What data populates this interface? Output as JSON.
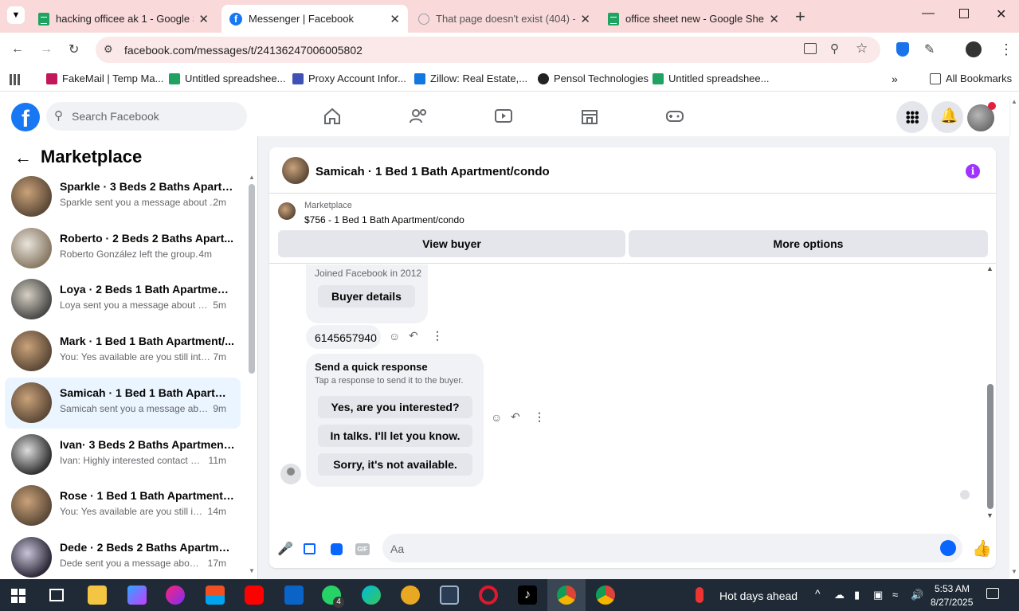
{
  "browser": {
    "tabs": [
      {
        "title": "hacking officee ak 1 - Google S",
        "icon": "google-sheets-icon"
      },
      {
        "title": "Messenger | Facebook",
        "icon": "facebook-icon"
      },
      {
        "title": "That page doesn't exist (404) -",
        "icon": "error-icon"
      },
      {
        "title": "office sheet new - Google Shee",
        "icon": "google-sheets-icon"
      }
    ],
    "new_tab": "+",
    "url": "facebook.com/messages/t/24136247006005802",
    "bookmarks": [
      {
        "label": "FakeMail | Temp Ma...",
        "color": "#c2185b"
      },
      {
        "label": "Untitled spreadshee...",
        "color": "#1ea362"
      },
      {
        "label": "Proxy Account Infor...",
        "color": "#3f51b5"
      },
      {
        "label": "Zillow: Real Estate,...",
        "color": "#1277e1"
      },
      {
        "label": "Pensol Technologies",
        "color": "#222222"
      },
      {
        "label": "Untitled spreadshee...",
        "color": "#1ea362"
      }
    ],
    "all_bookmarks": "All Bookmarks"
  },
  "fb": {
    "search_placeholder": "Search Facebook",
    "logo": "f"
  },
  "left": {
    "title": "Marketplace",
    "conversations": [
      {
        "name": "Sparkle · 3 Beds 2 Baths Apartm...",
        "preview": "Sparkle sent you a message about ...",
        "time": "2m"
      },
      {
        "name": "Roberto · 2 Beds 2 Baths Apart...",
        "preview": "Roberto González left the group.",
        "time": "4m"
      },
      {
        "name": "Loya · 2 Beds 1 Bath Apartment/...",
        "preview": "Loya sent you a message about yo...",
        "time": "5m"
      },
      {
        "name": "Mark · 1 Bed 1 Bath Apartment/...",
        "preview": "You: Yes available are you still inter...",
        "time": "7m"
      },
      {
        "name": "Samicah · 1 Bed 1 Bath Apartme...",
        "preview": "Samicah sent you a message abou...",
        "time": "9m",
        "selected": true
      },
      {
        "name": "Ivan· 3 Beds 2 Baths Apartment/...",
        "preview": "Ivan: Highly interested contact m...",
        "time": "11m"
      },
      {
        "name": "Rose · 1 Bed 1 Bath Apartment/c...",
        "preview": "You: Yes available are you still int...",
        "time": "14m"
      },
      {
        "name": "Dede · 2 Beds 2 Baths Apartmen...",
        "preview": "Dede sent you a message about ...",
        "time": "17m"
      }
    ]
  },
  "chat": {
    "title": "Samicah · 1 Bed 1 Bath Apartment/condo",
    "listing_source": "Marketplace",
    "listing_title": "$756 - 1 Bed 1 Bath Apartment/condo",
    "view_buyer": "View buyer",
    "more_options": "More options",
    "joined": "Joined Facebook in 2012",
    "buyer_details": "Buyer details",
    "phone": "6145657940",
    "quick_title": "Send a quick response",
    "quick_sub": "Tap a response to send it to the buyer.",
    "quick_options": [
      "Yes, are you interested?",
      "In talks. I'll let you know.",
      "Sorry, it's not available."
    ],
    "composer_placeholder": "Aa"
  },
  "taskbar": {
    "weather": "Hot days ahead",
    "time": "5:53 AM",
    "date": "8/27/2025",
    "whatsapp_badge": "4"
  }
}
